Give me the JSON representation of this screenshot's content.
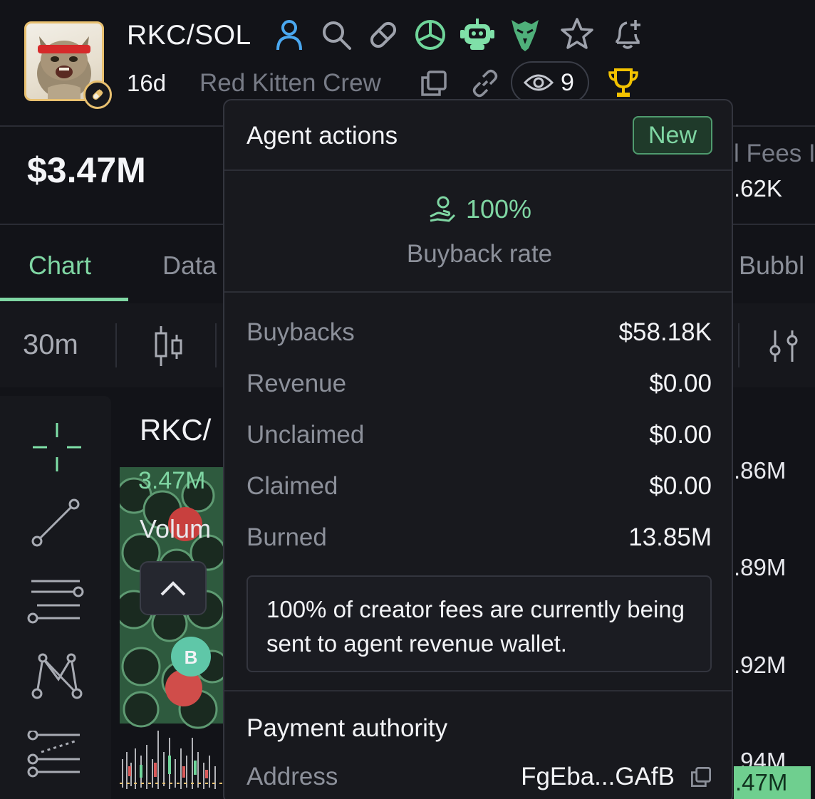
{
  "token": {
    "pair": "RKC/SOL",
    "age": "16d",
    "name": "Red Kitten Crew",
    "watchers": "9"
  },
  "stats": {
    "market_cap": "$3.47M",
    "fees_label": "l Fees I",
    "fees_value": ".62K"
  },
  "tabs": [
    {
      "label": "Chart",
      "active": true
    },
    {
      "label": "Data",
      "active": false
    },
    {
      "label": "Bubbl",
      "active": false
    }
  ],
  "toolbar": {
    "timeframe": "30m"
  },
  "chart": {
    "title": "RKC/",
    "price": "3.47M",
    "volume_label": "Volum",
    "axis_labels": [
      ".86M",
      ".89M",
      ".92M",
      ".94M"
    ],
    "current_price_tag": ".47M"
  },
  "popover": {
    "title": "Agent actions",
    "badge": "New",
    "rate_value": "100%",
    "rate_label": "Buyback rate",
    "rows": [
      {
        "label": "Buybacks",
        "value": "$58.18K"
      },
      {
        "label": "Revenue",
        "value": "$0.00"
      },
      {
        "label": "Unclaimed",
        "value": "$0.00"
      },
      {
        "label": "Claimed",
        "value": "$0.00"
      },
      {
        "label": "Burned",
        "value": "13.85M"
      }
    ],
    "note": "100% of creator fees are currently being sent to agent revenue wallet.",
    "payment_title": "Payment authority",
    "address_label": "Address",
    "address_value": "FgEba...GAfB"
  },
  "colors": {
    "background": "#121318",
    "accent_green": "#7fd6a3",
    "gold": "#e8c070",
    "muted_text": "#8c909a"
  },
  "icons": [
    "user-icon",
    "search-icon",
    "pill-icon",
    "pie-chart-icon",
    "robot-icon",
    "eagle-icon",
    "star-icon",
    "bell-plus-icon",
    "copy-icon",
    "link-icon",
    "eye-icon",
    "trophy-icon"
  ]
}
